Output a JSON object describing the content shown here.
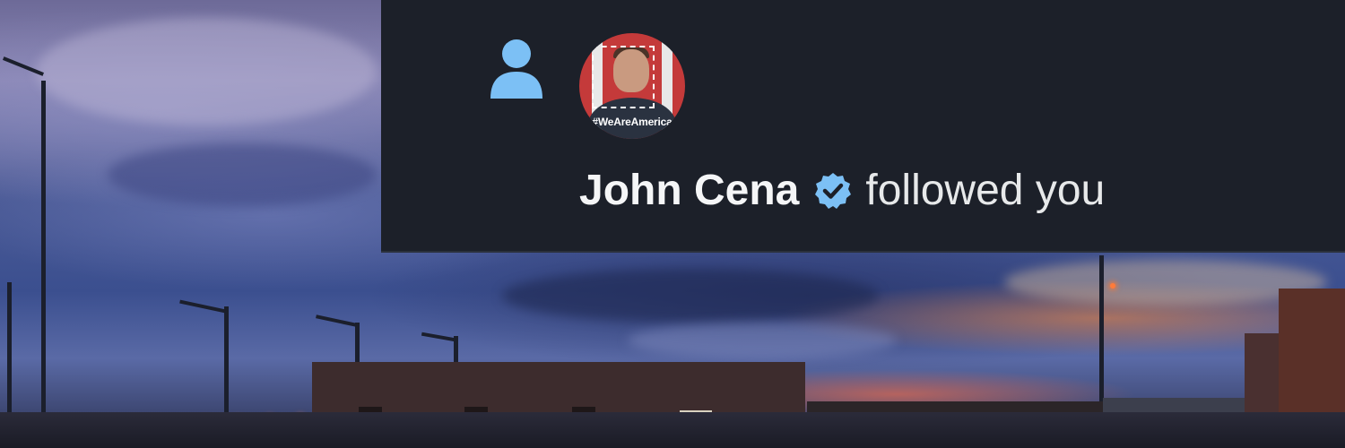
{
  "notification": {
    "type_icon": "person-icon",
    "avatar": {
      "icon": "avatar",
      "caption": "#WeAreAmerica"
    },
    "user_name": "John Cena",
    "verified_icon": "verified-badge-icon",
    "action_text": "followed you"
  },
  "colors": {
    "card_background": "#1c2029",
    "accent_blue": "#7cc0f5",
    "text_primary": "#e7e9ea"
  }
}
